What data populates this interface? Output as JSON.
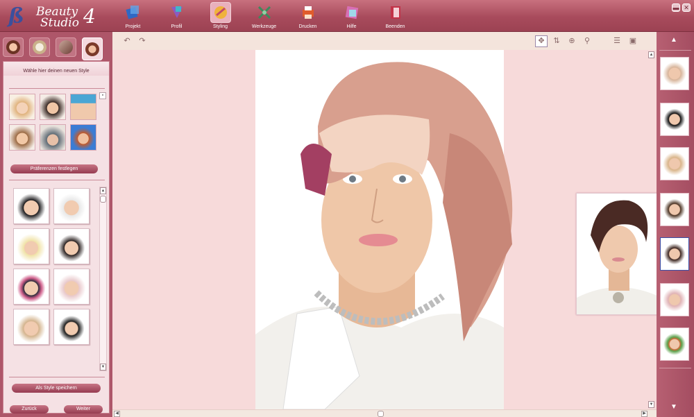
{
  "app": {
    "logo_line1": "Beauty",
    "logo_line2": "Studio",
    "logo_version": "4"
  },
  "menu": {
    "items": [
      {
        "label": "Projekt",
        "icon": "project-icon",
        "color": "#3b6dc2"
      },
      {
        "label": "Profil",
        "icon": "profile-icon",
        "color": "#7d4fb2"
      },
      {
        "label": "Styling",
        "icon": "styling-icon",
        "color": "#e8a13c",
        "active": true
      },
      {
        "label": "Werkzeuge",
        "icon": "tools-icon",
        "color": "#3f8c5a"
      },
      {
        "label": "Drucken",
        "icon": "print-icon",
        "color": "#e2562f"
      },
      {
        "label": "Hilfe",
        "icon": "help-icon",
        "color": "#d46bb0"
      },
      {
        "label": "Beenden",
        "icon": "exit-icon",
        "color": "#c33348"
      }
    ]
  },
  "window": {
    "minimize": "▬",
    "close": "✕"
  },
  "left_panel": {
    "heading": "Wähle hier deinen neuen Style",
    "pref_button": "Präferenzen festlegen",
    "save_button": "Als Style speichern",
    "back_button": "Zurück",
    "next_button": "Weiter"
  },
  "colors": {
    "accent": "#a84b5c",
    "panel_bg": "#f5e1e4",
    "canvas_bg": "#f7dada"
  }
}
